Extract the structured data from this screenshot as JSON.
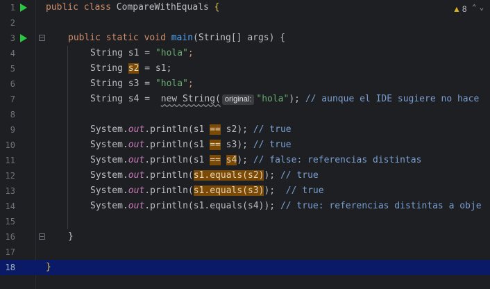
{
  "editor": {
    "class_name": "CompareWithEquals",
    "warnings_count": "8",
    "current_line": 18,
    "line_numbers": [
      "1",
      "2",
      "3",
      "4",
      "5",
      "6",
      "7",
      "8",
      "9",
      "10",
      "11",
      "12",
      "13",
      "14",
      "15",
      "16",
      "17",
      "18"
    ],
    "inlay_hint": "original:",
    "lines": {
      "l1": {
        "kw1": "public",
        "kw2": "class",
        "name": "CompareWithEquals",
        "brace": "{"
      },
      "l3": {
        "kw1": "public",
        "kw2": "static",
        "kw3": "void",
        "method": "main",
        "params": "(String[] args) {"
      },
      "l4": {
        "decl": "String s1 = ",
        "str": "\"hola\"",
        "end": ";"
      },
      "l5": {
        "decl": "String ",
        "var": "s2",
        "rest": " = s1;"
      },
      "l6": {
        "decl": "String s3 = ",
        "str": "\"hola\"",
        "end": ";"
      },
      "l7": {
        "decl": "String s4 = ",
        "new": "new String(",
        "str": "\"hola\"",
        "end": ");",
        "comment": " // aunque el IDE sugiere no hace"
      },
      "l9": {
        "obj": "System.",
        "field": "out",
        "call": ".println(s1 ",
        "op": "==",
        "rest": " s2);",
        "comment": " // true"
      },
      "l10": {
        "obj": "System.",
        "field": "out",
        "call": ".println(s1 ",
        "op": "==",
        "rest": " s3);",
        "comment": " // true"
      },
      "l11": {
        "obj": "System.",
        "field": "out",
        "call": ".println(s1 ",
        "op": "==",
        "s4": "s4",
        "rest": ");",
        "comment": " // false: referencias distintas"
      },
      "l12": {
        "obj": "System.",
        "field": "out",
        "call": ".println(",
        "expr": "s1.equals(s2)",
        "rest": ");",
        "comment": " // true"
      },
      "l13": {
        "obj": "System.",
        "field": "out",
        "call": ".println(",
        "expr": "s1.equals(s3)",
        "rest": ");",
        "comment": "  // true"
      },
      "l14": {
        "obj": "System.",
        "field": "out",
        "call": ".println(s1.equals(s4));",
        "comment": " // true: referencias distintas a obje"
      },
      "l16": {
        "brace": "}"
      },
      "l18": {
        "brace": "}"
      }
    }
  }
}
